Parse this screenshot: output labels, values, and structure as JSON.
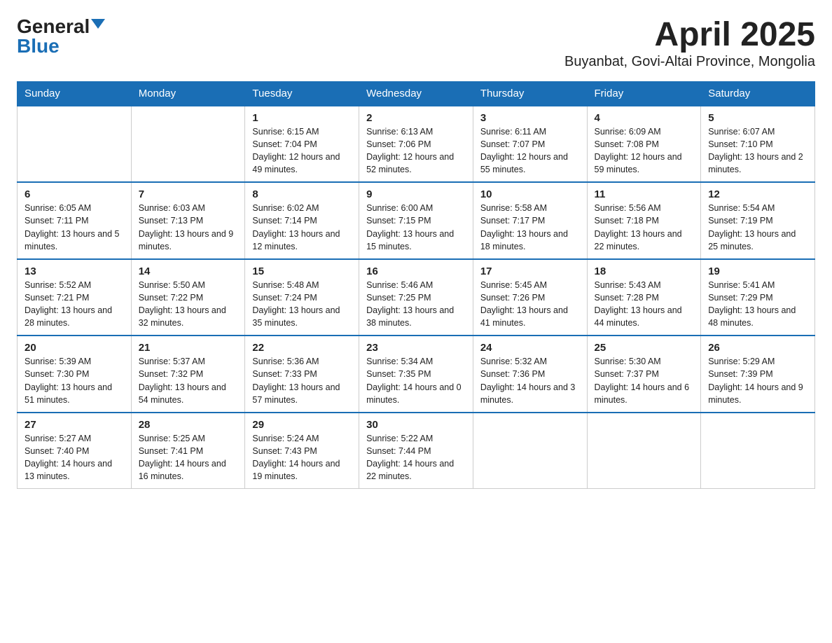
{
  "logo": {
    "general": "General",
    "blue": "Blue",
    "triangle": "▼"
  },
  "title": "April 2025",
  "subtitle": "Buyanbat, Govi-Altai Province, Mongolia",
  "headers": [
    "Sunday",
    "Monday",
    "Tuesday",
    "Wednesday",
    "Thursday",
    "Friday",
    "Saturday"
  ],
  "weeks": [
    [
      {
        "day": "",
        "sunrise": "",
        "sunset": "",
        "daylight": ""
      },
      {
        "day": "",
        "sunrise": "",
        "sunset": "",
        "daylight": ""
      },
      {
        "day": "1",
        "sunrise": "Sunrise: 6:15 AM",
        "sunset": "Sunset: 7:04 PM",
        "daylight": "Daylight: 12 hours and 49 minutes."
      },
      {
        "day": "2",
        "sunrise": "Sunrise: 6:13 AM",
        "sunset": "Sunset: 7:06 PM",
        "daylight": "Daylight: 12 hours and 52 minutes."
      },
      {
        "day": "3",
        "sunrise": "Sunrise: 6:11 AM",
        "sunset": "Sunset: 7:07 PM",
        "daylight": "Daylight: 12 hours and 55 minutes."
      },
      {
        "day": "4",
        "sunrise": "Sunrise: 6:09 AM",
        "sunset": "Sunset: 7:08 PM",
        "daylight": "Daylight: 12 hours and 59 minutes."
      },
      {
        "day": "5",
        "sunrise": "Sunrise: 6:07 AM",
        "sunset": "Sunset: 7:10 PM",
        "daylight": "Daylight: 13 hours and 2 minutes."
      }
    ],
    [
      {
        "day": "6",
        "sunrise": "Sunrise: 6:05 AM",
        "sunset": "Sunset: 7:11 PM",
        "daylight": "Daylight: 13 hours and 5 minutes."
      },
      {
        "day": "7",
        "sunrise": "Sunrise: 6:03 AM",
        "sunset": "Sunset: 7:13 PM",
        "daylight": "Daylight: 13 hours and 9 minutes."
      },
      {
        "day": "8",
        "sunrise": "Sunrise: 6:02 AM",
        "sunset": "Sunset: 7:14 PM",
        "daylight": "Daylight: 13 hours and 12 minutes."
      },
      {
        "day": "9",
        "sunrise": "Sunrise: 6:00 AM",
        "sunset": "Sunset: 7:15 PM",
        "daylight": "Daylight: 13 hours and 15 minutes."
      },
      {
        "day": "10",
        "sunrise": "Sunrise: 5:58 AM",
        "sunset": "Sunset: 7:17 PM",
        "daylight": "Daylight: 13 hours and 18 minutes."
      },
      {
        "day": "11",
        "sunrise": "Sunrise: 5:56 AM",
        "sunset": "Sunset: 7:18 PM",
        "daylight": "Daylight: 13 hours and 22 minutes."
      },
      {
        "day": "12",
        "sunrise": "Sunrise: 5:54 AM",
        "sunset": "Sunset: 7:19 PM",
        "daylight": "Daylight: 13 hours and 25 minutes."
      }
    ],
    [
      {
        "day": "13",
        "sunrise": "Sunrise: 5:52 AM",
        "sunset": "Sunset: 7:21 PM",
        "daylight": "Daylight: 13 hours and 28 minutes."
      },
      {
        "day": "14",
        "sunrise": "Sunrise: 5:50 AM",
        "sunset": "Sunset: 7:22 PM",
        "daylight": "Daylight: 13 hours and 32 minutes."
      },
      {
        "day": "15",
        "sunrise": "Sunrise: 5:48 AM",
        "sunset": "Sunset: 7:24 PM",
        "daylight": "Daylight: 13 hours and 35 minutes."
      },
      {
        "day": "16",
        "sunrise": "Sunrise: 5:46 AM",
        "sunset": "Sunset: 7:25 PM",
        "daylight": "Daylight: 13 hours and 38 minutes."
      },
      {
        "day": "17",
        "sunrise": "Sunrise: 5:45 AM",
        "sunset": "Sunset: 7:26 PM",
        "daylight": "Daylight: 13 hours and 41 minutes."
      },
      {
        "day": "18",
        "sunrise": "Sunrise: 5:43 AM",
        "sunset": "Sunset: 7:28 PM",
        "daylight": "Daylight: 13 hours and 44 minutes."
      },
      {
        "day": "19",
        "sunrise": "Sunrise: 5:41 AM",
        "sunset": "Sunset: 7:29 PM",
        "daylight": "Daylight: 13 hours and 48 minutes."
      }
    ],
    [
      {
        "day": "20",
        "sunrise": "Sunrise: 5:39 AM",
        "sunset": "Sunset: 7:30 PM",
        "daylight": "Daylight: 13 hours and 51 minutes."
      },
      {
        "day": "21",
        "sunrise": "Sunrise: 5:37 AM",
        "sunset": "Sunset: 7:32 PM",
        "daylight": "Daylight: 13 hours and 54 minutes."
      },
      {
        "day": "22",
        "sunrise": "Sunrise: 5:36 AM",
        "sunset": "Sunset: 7:33 PM",
        "daylight": "Daylight: 13 hours and 57 minutes."
      },
      {
        "day": "23",
        "sunrise": "Sunrise: 5:34 AM",
        "sunset": "Sunset: 7:35 PM",
        "daylight": "Daylight: 14 hours and 0 minutes."
      },
      {
        "day": "24",
        "sunrise": "Sunrise: 5:32 AM",
        "sunset": "Sunset: 7:36 PM",
        "daylight": "Daylight: 14 hours and 3 minutes."
      },
      {
        "day": "25",
        "sunrise": "Sunrise: 5:30 AM",
        "sunset": "Sunset: 7:37 PM",
        "daylight": "Daylight: 14 hours and 6 minutes."
      },
      {
        "day": "26",
        "sunrise": "Sunrise: 5:29 AM",
        "sunset": "Sunset: 7:39 PM",
        "daylight": "Daylight: 14 hours and 9 minutes."
      }
    ],
    [
      {
        "day": "27",
        "sunrise": "Sunrise: 5:27 AM",
        "sunset": "Sunset: 7:40 PM",
        "daylight": "Daylight: 14 hours and 13 minutes."
      },
      {
        "day": "28",
        "sunrise": "Sunrise: 5:25 AM",
        "sunset": "Sunset: 7:41 PM",
        "daylight": "Daylight: 14 hours and 16 minutes."
      },
      {
        "day": "29",
        "sunrise": "Sunrise: 5:24 AM",
        "sunset": "Sunset: 7:43 PM",
        "daylight": "Daylight: 14 hours and 19 minutes."
      },
      {
        "day": "30",
        "sunrise": "Sunrise: 5:22 AM",
        "sunset": "Sunset: 7:44 PM",
        "daylight": "Daylight: 14 hours and 22 minutes."
      },
      {
        "day": "",
        "sunrise": "",
        "sunset": "",
        "daylight": ""
      },
      {
        "day": "",
        "sunrise": "",
        "sunset": "",
        "daylight": ""
      },
      {
        "day": "",
        "sunrise": "",
        "sunset": "",
        "daylight": ""
      }
    ]
  ]
}
